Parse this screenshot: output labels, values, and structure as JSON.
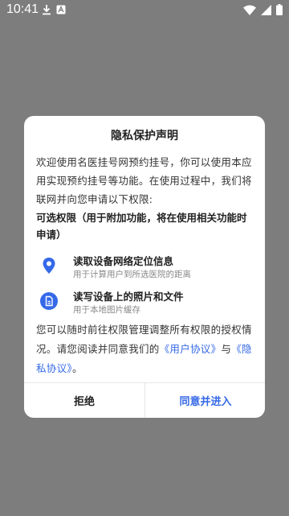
{
  "status_bar": {
    "time": "10:41",
    "left_icons": [
      "download-icon",
      "app-notification-icon"
    ],
    "right_icons": [
      "wifi-icon",
      "signal-icon",
      "battery-icon"
    ]
  },
  "dialog": {
    "title": "隐私保护声明",
    "intro": "欢迎使用名医挂号网预约挂号，你可以使用本应用实现预约挂号等功能。在使用过程中，我们将联网并向您申请以下权限:",
    "optional_heading": "可选权限（用于附加功能，将在使用相关功能时申请）",
    "permissions": [
      {
        "icon": "location-pin-icon",
        "title": "读取设备网络定位信息",
        "desc": "用于计算用户到所选医院的距离"
      },
      {
        "icon": "file-icon",
        "title": "读写设备上的照片和文件",
        "desc": "用于本地图片缓存"
      }
    ],
    "outro_prefix": "您可以随时前往权限管理调整所有权限的授权情况。请您阅读并同意我们的",
    "user_agreement": "《用户协议》",
    "conjunction": "与",
    "privacy_agreement": "《隐私协议》",
    "outro_suffix": "。",
    "reject_label": "拒绝",
    "accept_label": "同意并进入"
  },
  "colors": {
    "accent": "#3569e8",
    "overlay": "#7d7d7d"
  }
}
